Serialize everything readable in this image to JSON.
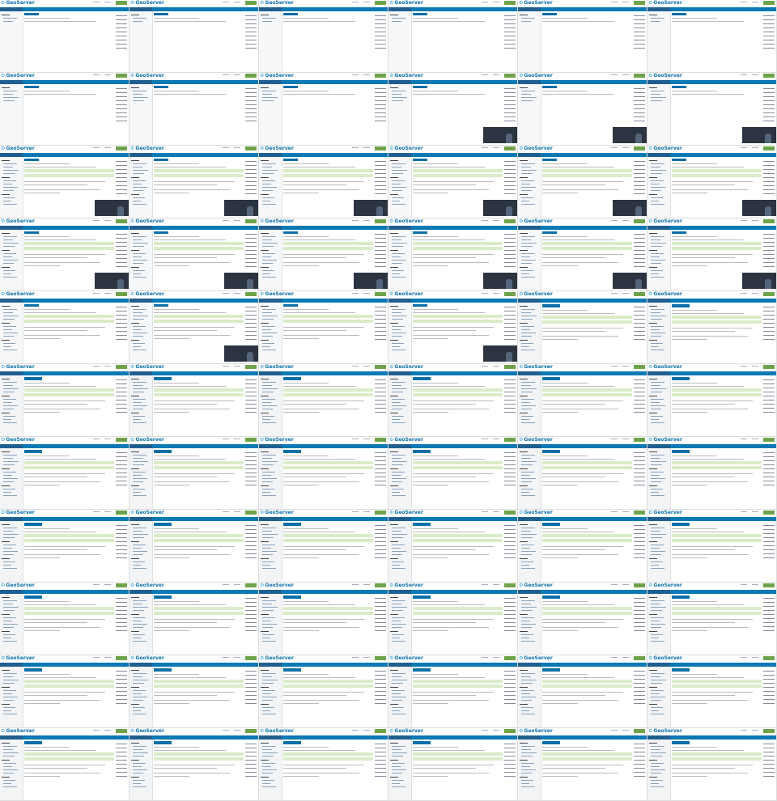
{
  "app": {
    "logo_text": "GeoServer",
    "logo_icon": "gear-icon"
  },
  "welcome_heading_en": "Welcome",
  "welcome_heading_de": "Willkommen",
  "colors": {
    "brand_blue": "#0a79b4",
    "login_green": "#6fa34a",
    "status_green": "#d9ecc8"
  },
  "frames": [
    {
      "lang": "en",
      "stage": "blank",
      "video": false
    },
    {
      "lang": "en",
      "stage": "blank",
      "video": false
    },
    {
      "lang": "en",
      "stage": "blank",
      "video": false
    },
    {
      "lang": "en",
      "stage": "blank",
      "video": false
    },
    {
      "lang": "en",
      "stage": "blank",
      "video": false
    },
    {
      "lang": "en",
      "stage": "blank",
      "video": false
    },
    {
      "lang": "en",
      "stage": "login",
      "video": false
    },
    {
      "lang": "en",
      "stage": "login",
      "video": false
    },
    {
      "lang": "en",
      "stage": "login",
      "video": false
    },
    {
      "lang": "en",
      "stage": "login",
      "video": true
    },
    {
      "lang": "en",
      "stage": "login",
      "video": true
    },
    {
      "lang": "en",
      "stage": "login",
      "video": true
    },
    {
      "lang": "en",
      "stage": "admin",
      "video": true
    },
    {
      "lang": "en",
      "stage": "admin",
      "video": true
    },
    {
      "lang": "en",
      "stage": "admin",
      "video": true
    },
    {
      "lang": "en",
      "stage": "admin",
      "video": true
    },
    {
      "lang": "en",
      "stage": "admin",
      "video": true
    },
    {
      "lang": "en",
      "stage": "admin",
      "video": true
    },
    {
      "lang": "en",
      "stage": "admin",
      "video": true
    },
    {
      "lang": "en",
      "stage": "admin",
      "video": true
    },
    {
      "lang": "en",
      "stage": "admin",
      "video": true
    },
    {
      "lang": "en",
      "stage": "admin",
      "video": true
    },
    {
      "lang": "en",
      "stage": "admin",
      "video": true
    },
    {
      "lang": "en",
      "stage": "admin",
      "video": true
    },
    {
      "lang": "en",
      "stage": "admin",
      "video": false
    },
    {
      "lang": "en",
      "stage": "admin",
      "video": true
    },
    {
      "lang": "en",
      "stage": "admin",
      "video": false
    },
    {
      "lang": "en",
      "stage": "admin",
      "video": true
    },
    {
      "lang": "de",
      "stage": "admin",
      "video": false
    },
    {
      "lang": "de",
      "stage": "admin",
      "video": false
    },
    {
      "lang": "de",
      "stage": "admin",
      "video": false
    },
    {
      "lang": "de",
      "stage": "admin",
      "video": false
    },
    {
      "lang": "de",
      "stage": "admin",
      "video": false
    },
    {
      "lang": "de",
      "stage": "admin",
      "video": false
    },
    {
      "lang": "de",
      "stage": "admin",
      "video": false
    },
    {
      "lang": "de",
      "stage": "admin",
      "video": false
    },
    {
      "lang": "de",
      "stage": "admin",
      "video": false
    },
    {
      "lang": "de",
      "stage": "admin",
      "video": false
    },
    {
      "lang": "de",
      "stage": "admin",
      "video": false
    },
    {
      "lang": "de",
      "stage": "admin",
      "video": false
    },
    {
      "lang": "de",
      "stage": "admin",
      "video": false
    },
    {
      "lang": "de",
      "stage": "admin",
      "video": false
    },
    {
      "lang": "de",
      "stage": "admin",
      "video": false
    },
    {
      "lang": "de",
      "stage": "admin",
      "video": false
    },
    {
      "lang": "de",
      "stage": "admin",
      "video": false
    },
    {
      "lang": "de",
      "stage": "admin",
      "video": false
    },
    {
      "lang": "de",
      "stage": "admin",
      "video": false
    },
    {
      "lang": "de",
      "stage": "admin",
      "video": false
    },
    {
      "lang": "de",
      "stage": "admin",
      "video": false
    },
    {
      "lang": "de",
      "stage": "admin",
      "video": false
    },
    {
      "lang": "de",
      "stage": "admin",
      "video": false
    },
    {
      "lang": "de",
      "stage": "admin",
      "video": false
    },
    {
      "lang": "de",
      "stage": "admin",
      "video": false
    },
    {
      "lang": "de",
      "stage": "admin",
      "video": false
    },
    {
      "lang": "de",
      "stage": "admin",
      "video": false
    },
    {
      "lang": "de",
      "stage": "admin",
      "video": false
    },
    {
      "lang": "de",
      "stage": "admin",
      "video": false
    },
    {
      "lang": "de",
      "stage": "admin",
      "video": false
    },
    {
      "lang": "de",
      "stage": "admin",
      "video": false
    },
    {
      "lang": "de",
      "stage": "admin",
      "video": false
    },
    {
      "lang": "de",
      "stage": "admin",
      "video": false
    },
    {
      "lang": "de",
      "stage": "admin",
      "video": false
    },
    {
      "lang": "de",
      "stage": "admin",
      "video": false
    },
    {
      "lang": "de",
      "stage": "admin",
      "video": false
    },
    {
      "lang": "de",
      "stage": "admin",
      "video": false
    },
    {
      "lang": "de",
      "stage": "admin",
      "video": false
    }
  ]
}
